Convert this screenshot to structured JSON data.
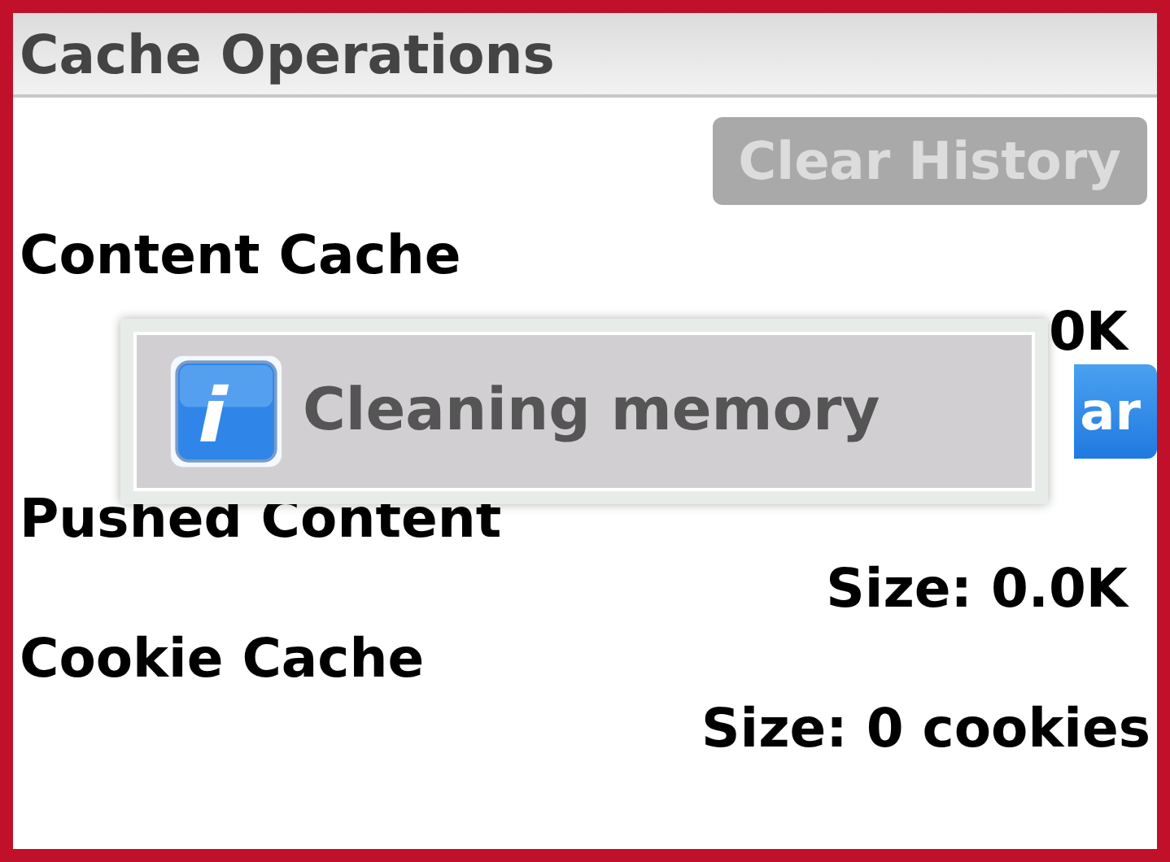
{
  "header": {
    "title": "Cache Operations"
  },
  "clear_history_button": {
    "label": "Clear History",
    "disabled": true
  },
  "sections": [
    {
      "name": "Content Cache",
      "size": "0K",
      "button": {
        "label": "ar",
        "disabled": false
      }
    },
    {
      "name": "Pushed Content",
      "size": "Size: 0.0K"
    },
    {
      "name": "Cookie Cache",
      "size": "Size: 0 cookies"
    }
  ],
  "popup": {
    "message": "Cleaning memory"
  }
}
